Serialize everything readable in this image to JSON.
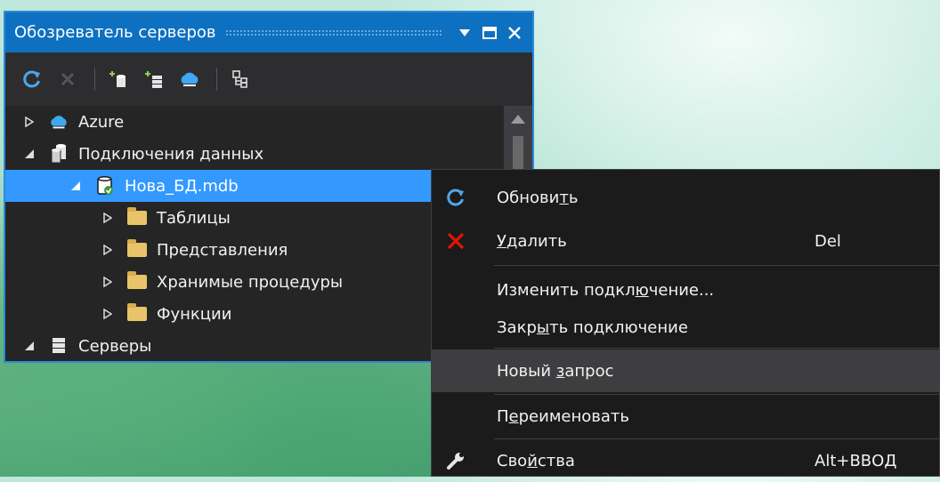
{
  "panel": {
    "title": "Обозреватель серверов",
    "title_buttons": [
      "dropdown-icon",
      "maximize-icon",
      "close-icon"
    ],
    "toolbar": [
      "refresh-icon",
      "stop-icon",
      "connect-database-icon",
      "connect-server-icon",
      "azure-connect-icon",
      "hierarchy-icon"
    ]
  },
  "tree": {
    "items": [
      {
        "label": "Azure",
        "icon": "azure-icon",
        "expanded": false,
        "level": 0
      },
      {
        "label": "Подключения данных",
        "icon": "data-connections-icon",
        "expanded": true,
        "level": 0
      },
      {
        "label": "Нова_БД.mdb",
        "icon": "database-icon",
        "expanded": true,
        "level": 1,
        "selected": true
      },
      {
        "label": "Таблицы",
        "icon": "folder-icon",
        "expanded": false,
        "level": 2
      },
      {
        "label": "Представления",
        "icon": "folder-icon",
        "expanded": false,
        "level": 2
      },
      {
        "label": "Хранимые процедуры",
        "icon": "folder-icon",
        "expanded": false,
        "level": 2
      },
      {
        "label": "Функции",
        "icon": "folder-icon",
        "expanded": false,
        "level": 2
      },
      {
        "label": "Серверы",
        "icon": "servers-icon",
        "expanded": true,
        "level": 0
      }
    ]
  },
  "menu": {
    "refresh": {
      "pre": "Обнови",
      "ul": "т",
      "post": "ь",
      "icon": "refresh-icon"
    },
    "delete": {
      "pre": "",
      "ul": "У",
      "post": "далить",
      "shortcut": "Del",
      "icon": "delete-icon"
    },
    "edit_connection": {
      "pre": "Изменить подкл",
      "ul": "ю",
      "post": "чение..."
    },
    "close_connection": {
      "pre": "Закр",
      "ul": "ы",
      "post": "ть подключение"
    },
    "new_query": {
      "pre": "Новый ",
      "ul": "з",
      "post": "апрос"
    },
    "rename": {
      "pre": "П",
      "ul": "е",
      "post": "реименовать"
    },
    "properties": {
      "pre": "Сво",
      "ul": "й",
      "post": "ства",
      "shortcut": "Alt+ВВОД",
      "icon": "wrench-icon"
    }
  },
  "colors": {
    "accent": "#0e70c0",
    "selection": "#3399ff",
    "panel_bg": "#252526",
    "menu_bg": "#1b1b1c",
    "delete_red": "#e51400"
  }
}
